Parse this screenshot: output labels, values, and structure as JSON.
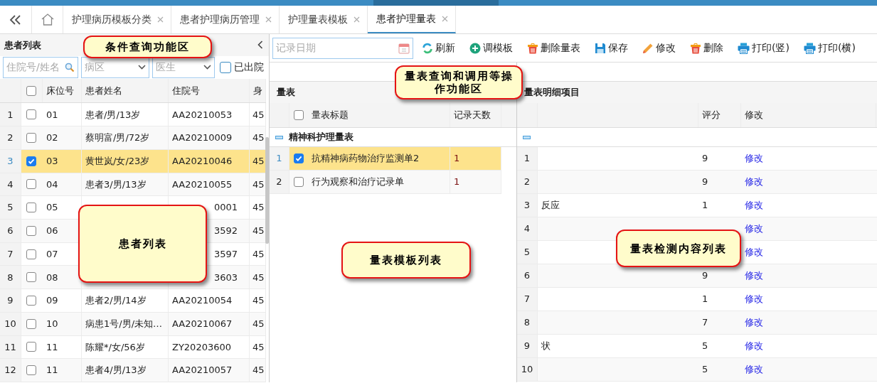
{
  "tabs": [
    {
      "label": "护理病历模板分类",
      "selected": false
    },
    {
      "label": "患者护理病历管理",
      "selected": false
    },
    {
      "label": "护理量表模板",
      "selected": false
    },
    {
      "label": "患者护理量表",
      "selected": true
    }
  ],
  "patient_panel": {
    "title": "患者列表",
    "search": {
      "placeholder": "住院号/姓名"
    },
    "ward": {
      "placeholder": "病区"
    },
    "doctor": {
      "placeholder": "医生"
    },
    "discharged": {
      "label": "已出院",
      "checked": false
    },
    "select_all": {
      "checked": false
    },
    "columns": [
      "床位号",
      "患者姓名",
      "住院号",
      "身"
    ],
    "rows": [
      {
        "index": "1",
        "bed": "01",
        "name": "患者/男/13岁",
        "id": "AA20210053",
        "column_5": "45",
        "selected": false
      },
      {
        "index": "2",
        "bed": "02",
        "name": "蔡明富/男/72岁",
        "id": "AA20210009",
        "column_5": "45",
        "selected": false
      },
      {
        "index": "3",
        "bed": "03",
        "name": "黄世岚/女/23岁",
        "id": "AA20210046",
        "column_5": "45",
        "selected": true
      },
      {
        "index": "4",
        "bed": "04",
        "name": "患者3/男/13岁",
        "id": "AA20210055",
        "column_5": "45",
        "selected": false
      },
      {
        "index": "5",
        "bed": "05",
        "id": "0001",
        "covered": true,
        "column_5": "45",
        "selected": false
      },
      {
        "index": "6",
        "bed": "06",
        "id": "3592",
        "covered": true,
        "column_5": "45",
        "selected": false
      },
      {
        "index": "7",
        "bed": "07",
        "id": "3597",
        "covered": true,
        "column_5": "45",
        "selected": false
      },
      {
        "index": "8",
        "bed": "08",
        "id": "3603",
        "covered": true,
        "column_5": "45",
        "selected": false
      },
      {
        "index": "9",
        "bed": "09",
        "name": "患者2/男/14岁",
        "id": "AA20210054",
        "column_5": "45",
        "selected": false
      },
      {
        "index": "10",
        "bed": "10",
        "name": "病患1号/男/未知…",
        "id": "AA20210067",
        "column_5": "45",
        "selected": false
      },
      {
        "index": "11",
        "bed": "11",
        "name": "陈耀*/女/56岁",
        "id": "ZY20203600",
        "column_5": "45",
        "selected": false
      },
      {
        "index": "12",
        "bed": "11",
        "name": "患者4/男/13岁",
        "id": "AA20210057",
        "column_5": "45",
        "selected": false
      }
    ]
  },
  "toolbar": {
    "date": {
      "placeholder": "记录日期"
    },
    "buttons": [
      {
        "label": "刷新"
      },
      {
        "label": "调模板"
      },
      {
        "label": "删除量表"
      },
      {
        "label": "保存"
      },
      {
        "label": "修改"
      },
      {
        "label": "删除"
      },
      {
        "label": "打印(竖)"
      },
      {
        "label": "打印(横)"
      }
    ]
  },
  "template_panel": {
    "title": "量表",
    "select_all": {
      "checked": false
    },
    "columns": [
      "量表标题",
      "记录天数"
    ],
    "group": {
      "label": "精神科护理量表",
      "expanded": true
    },
    "rows": [
      {
        "index": "1",
        "title": "抗精神病药物治疗监测单2",
        "days": "1",
        "selected": true
      },
      {
        "index": "2",
        "title": "行为观察和治疗记录单",
        "days": "1",
        "selected": false
      }
    ]
  },
  "detail_panel": {
    "title": "量表明细项目",
    "columns": [
      "评分",
      "修改"
    ],
    "group": {
      "expanded": true
    },
    "rows": [
      {
        "index": "1",
        "score": "9",
        "action": "修改"
      },
      {
        "index": "2",
        "score": "9",
        "action": "修改"
      },
      {
        "index": "3",
        "item": "反应",
        "score": "1",
        "action": "修改"
      },
      {
        "index": "4",
        "action": "修改"
      },
      {
        "index": "5",
        "action": "修改"
      },
      {
        "index": "6",
        "score": "9",
        "action": "修改"
      },
      {
        "index": "7",
        "score": "1",
        "action": "修改"
      },
      {
        "index": "8",
        "score": "7",
        "action": "修改"
      },
      {
        "index": "9",
        "item": "状",
        "score": "5",
        "action": "修改"
      },
      {
        "index": "10",
        "score": "5",
        "action": "修改"
      }
    ]
  },
  "callouts": [
    {
      "text": "条件查询功能区"
    },
    {
      "text": "量表查询和调用等操作功能区"
    },
    {
      "text": "患者列表"
    },
    {
      "text": "量表模板列表"
    },
    {
      "text": "量表检测内容列表"
    }
  ]
}
